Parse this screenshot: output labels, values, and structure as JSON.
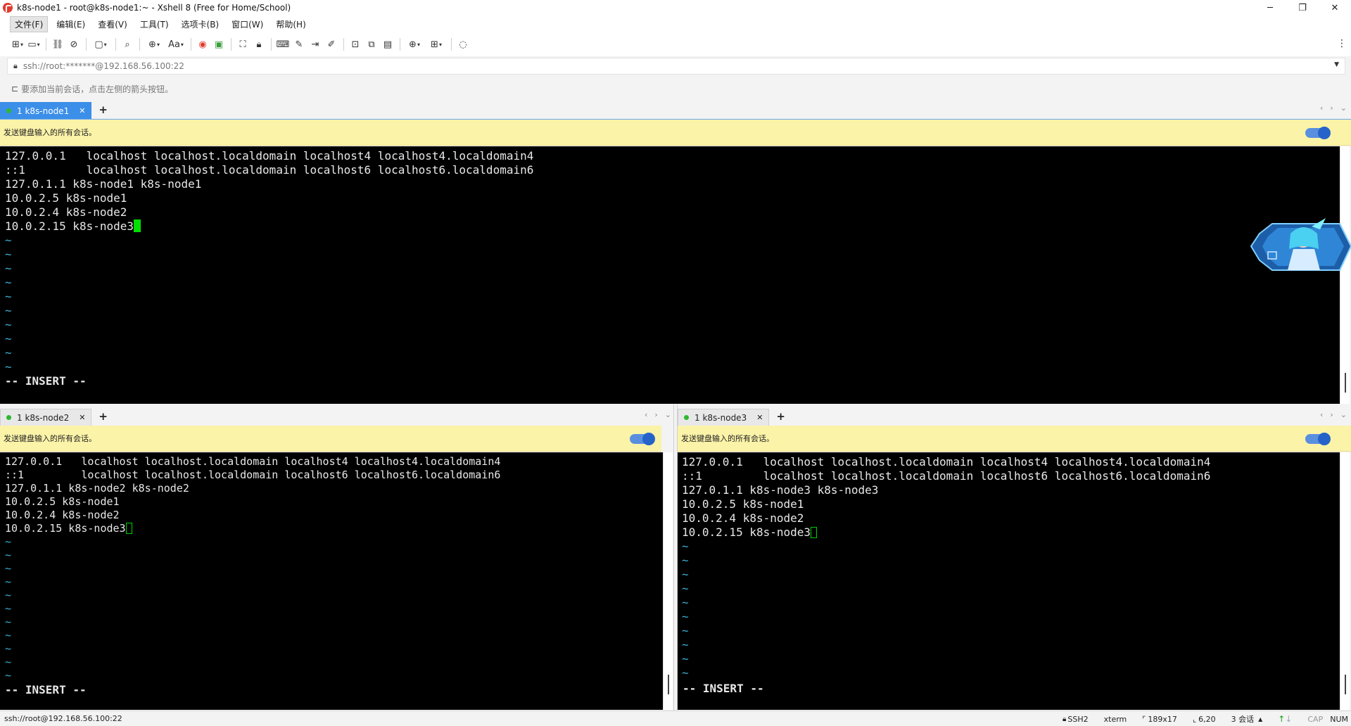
{
  "window": {
    "title": "k8s-node1 - root@k8s-node1:~ - Xshell 8 (Free for Home/School)",
    "controls": {
      "minimize": "─",
      "maximize": "❐",
      "close": "✕"
    }
  },
  "menu": [
    "文件(F)",
    "编辑(E)",
    "查看(V)",
    "工具(T)",
    "选项卡(B)",
    "窗口(W)",
    "帮助(H)"
  ],
  "address": {
    "value": "ssh://root:*******@192.168.56.100:22"
  },
  "hint": {
    "text": "要添加当前会话，点击左侧的箭头按钮。"
  },
  "send_bar": {
    "text": "发送键盘输入的所有会话。"
  },
  "panes": {
    "top": {
      "tab_label": "1 k8s-node1",
      "lines": [
        "127.0.0.1   localhost localhost.localdomain localhost4 localhost4.localdomain4",
        "::1         localhost localhost.localdomain localhost6 localhost6.localdomain6",
        "127.0.1.1 k8s-node1 k8s-node1",
        "10.0.2.5 k8s-node1",
        "10.0.2.4 k8s-node2",
        "10.0.2.15 k8s-node3"
      ],
      "tilde_count": 10,
      "mode_line": "-- INSERT --"
    },
    "bottom_left": {
      "tab_label": "1 k8s-node2",
      "lines": [
        "127.0.0.1   localhost localhost.localdomain localhost4 localhost4.localdomain4",
        "::1         localhost localhost.localdomain localhost6 localhost6.localdomain6",
        "127.0.1.1 k8s-node2 k8s-node2",
        "10.0.2.5 k8s-node1",
        "10.0.2.4 k8s-node2",
        "10.0.2.15 k8s-node3"
      ],
      "tilde_count": 11,
      "mode_line": "-- INSERT --"
    },
    "bottom_right": {
      "tab_label": "1 k8s-node3",
      "lines": [
        "127.0.0.1   localhost localhost.localdomain localhost4 localhost4.localdomain4",
        "::1         localhost localhost.localdomain localhost6 localhost6.localdomain6",
        "127.0.1.1 k8s-node3 k8s-node3",
        "10.0.2.5 k8s-node1",
        "10.0.2.4 k8s-node2",
        "10.0.2.15 k8s-node3"
      ],
      "tilde_count": 10,
      "mode_line": "-- INSERT --"
    }
  },
  "status": {
    "connection": "ssh://root@192.168.56.100:22",
    "protocol": "SSH2",
    "terminal": "xterm",
    "size": "189x17",
    "position": "6,20",
    "sessions": "3 会话",
    "cap": "CAP",
    "num": "NUM"
  },
  "colors": {
    "active_tab": "#3c8fe8",
    "send_bar_bg": "#fbf3a8",
    "terminal_bg": "#000000",
    "cursor": "#00e000",
    "tilde": "#3ab0d0"
  }
}
